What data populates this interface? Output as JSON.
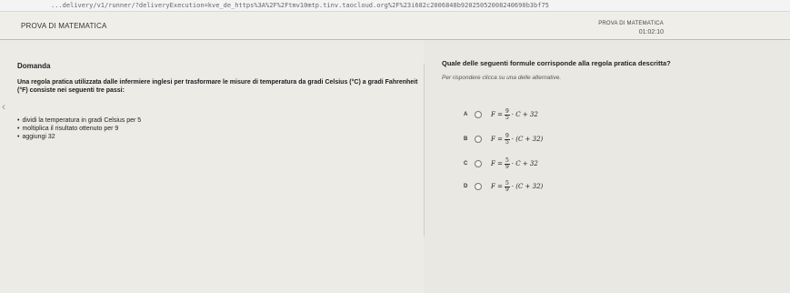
{
  "browser": {
    "url": "...delivery/v1/runner/?deliveryExecution=kve_de_https%3A%2F%2Ftmv10mtp.tinv.taocloud.org%2F%23i682c2006848b92025052008240690b3bf75"
  },
  "header": {
    "app_title": "PROVA DI MATEMATICA",
    "exam_title": "PROVA DI MATEMATICA",
    "timer": "01:02:10"
  },
  "left": {
    "domanda_label": "Domanda",
    "question_text": "Una regola pratica utilizzata dalle infermiere inglesi per trasformare le misure di temperatura da gradi Celsius (°C) a gradi Fahrenheit (°F) consiste nei seguenti tre passi:",
    "steps": [
      "dividi la temperatura in gradi Celsius per 5",
      "moltiplica il risultato ottenuto per 9",
      "aggiungi 32"
    ],
    "nav_arrow": "‹"
  },
  "right": {
    "question_title": "Quale delle seguenti formule corrisponde alla regola pratica descritta?",
    "instruction": "Per rispondere clicca su una delle alternative.",
    "options": [
      {
        "letter": "A",
        "lhs": "F =",
        "num": "9",
        "den": "5",
        "rhs": "· C + 32"
      },
      {
        "letter": "B",
        "lhs": "F =",
        "num": "9",
        "den": "5",
        "rhs": "· (C + 32)"
      },
      {
        "letter": "C",
        "lhs": "F =",
        "num": "5",
        "den": "9",
        "rhs": "· C + 32"
      },
      {
        "letter": "D",
        "lhs": "F =",
        "num": "5",
        "den": "9",
        "rhs": "· (C + 32)"
      }
    ]
  }
}
